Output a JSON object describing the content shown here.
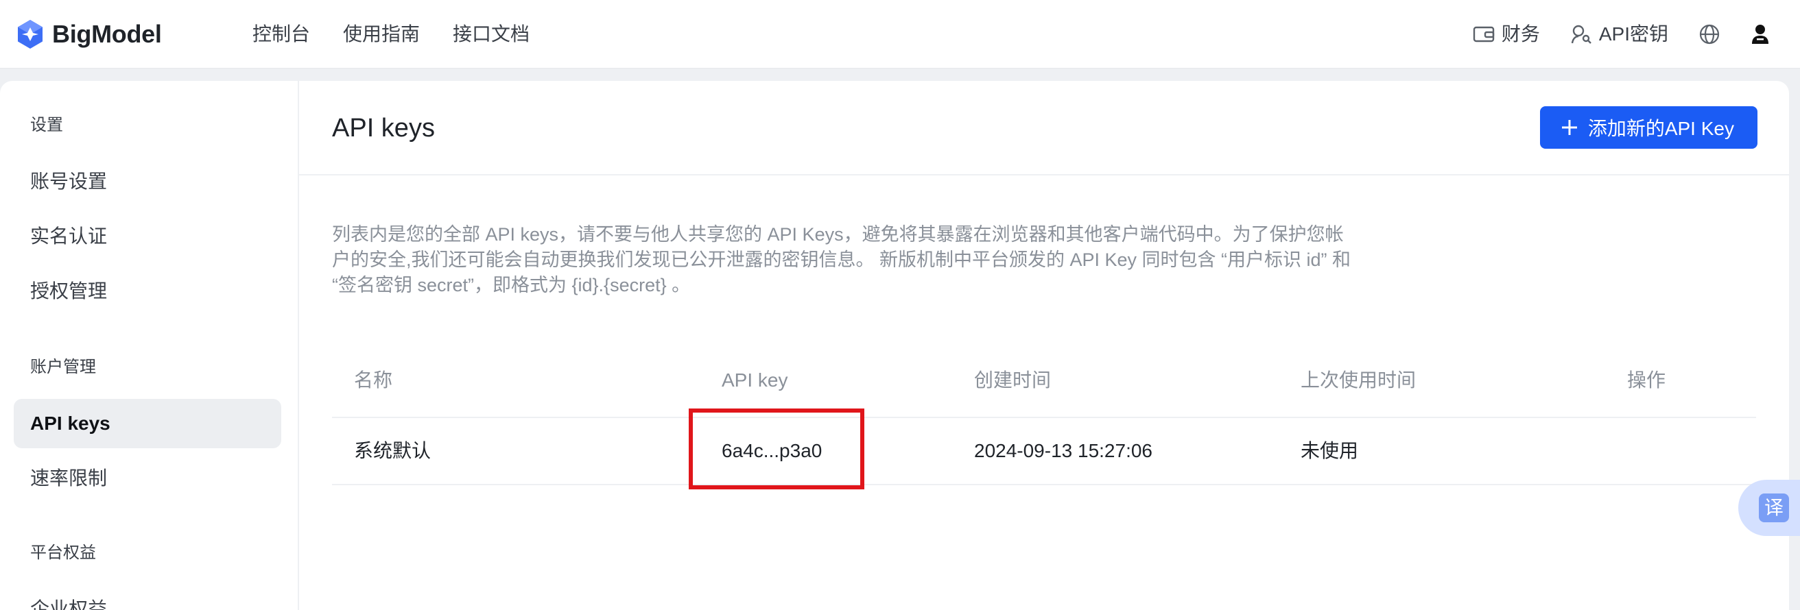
{
  "app": {
    "logo_text": "BigModel"
  },
  "nav": {
    "items": [
      "控制台",
      "使用指南",
      "接口文档"
    ]
  },
  "topbar_right": {
    "finance_label": "财务",
    "api_key_label": "API密钥"
  },
  "sidebar": {
    "groups": [
      {
        "title": "设置",
        "items": [
          "账号设置",
          "实名认证",
          "授权管理"
        ]
      },
      {
        "title": "账户管理",
        "items": [
          "API keys",
          "速率限制"
        ]
      },
      {
        "title": "平台权益",
        "items": [
          "企业权益"
        ]
      }
    ],
    "active_item": "API keys"
  },
  "main": {
    "title": "API keys",
    "add_button_label": "添加新的API Key",
    "description": "列表内是您的全部 API keys，请不要与他人共享您的 API Keys，避免将其暴露在浏览器和其他客户端代码中。为了保护您帐户的安全,我们还可能会自动更换我们发现已公开泄露的密钥信息。 新版机制中平台颁发的 API Key 同时包含 “用户标识 id” 和 “签名密钥 secret”，即格式为 {id}.{secret} 。"
  },
  "table": {
    "columns": [
      "名称",
      "API key",
      "创建时间",
      "上次使用时间",
      "操作"
    ],
    "rows": [
      {
        "name": "系统默认",
        "api_key": "6a4c...p3a0",
        "created": "2024-09-13 15:27:06",
        "last_used": "未使用",
        "action": ""
      }
    ]
  },
  "translate_fab": {
    "glyph": "译"
  },
  "colors": {
    "primary": "#1b5cf4",
    "highlight": "#e0161b",
    "logo_blue": "#3d6ef5"
  }
}
